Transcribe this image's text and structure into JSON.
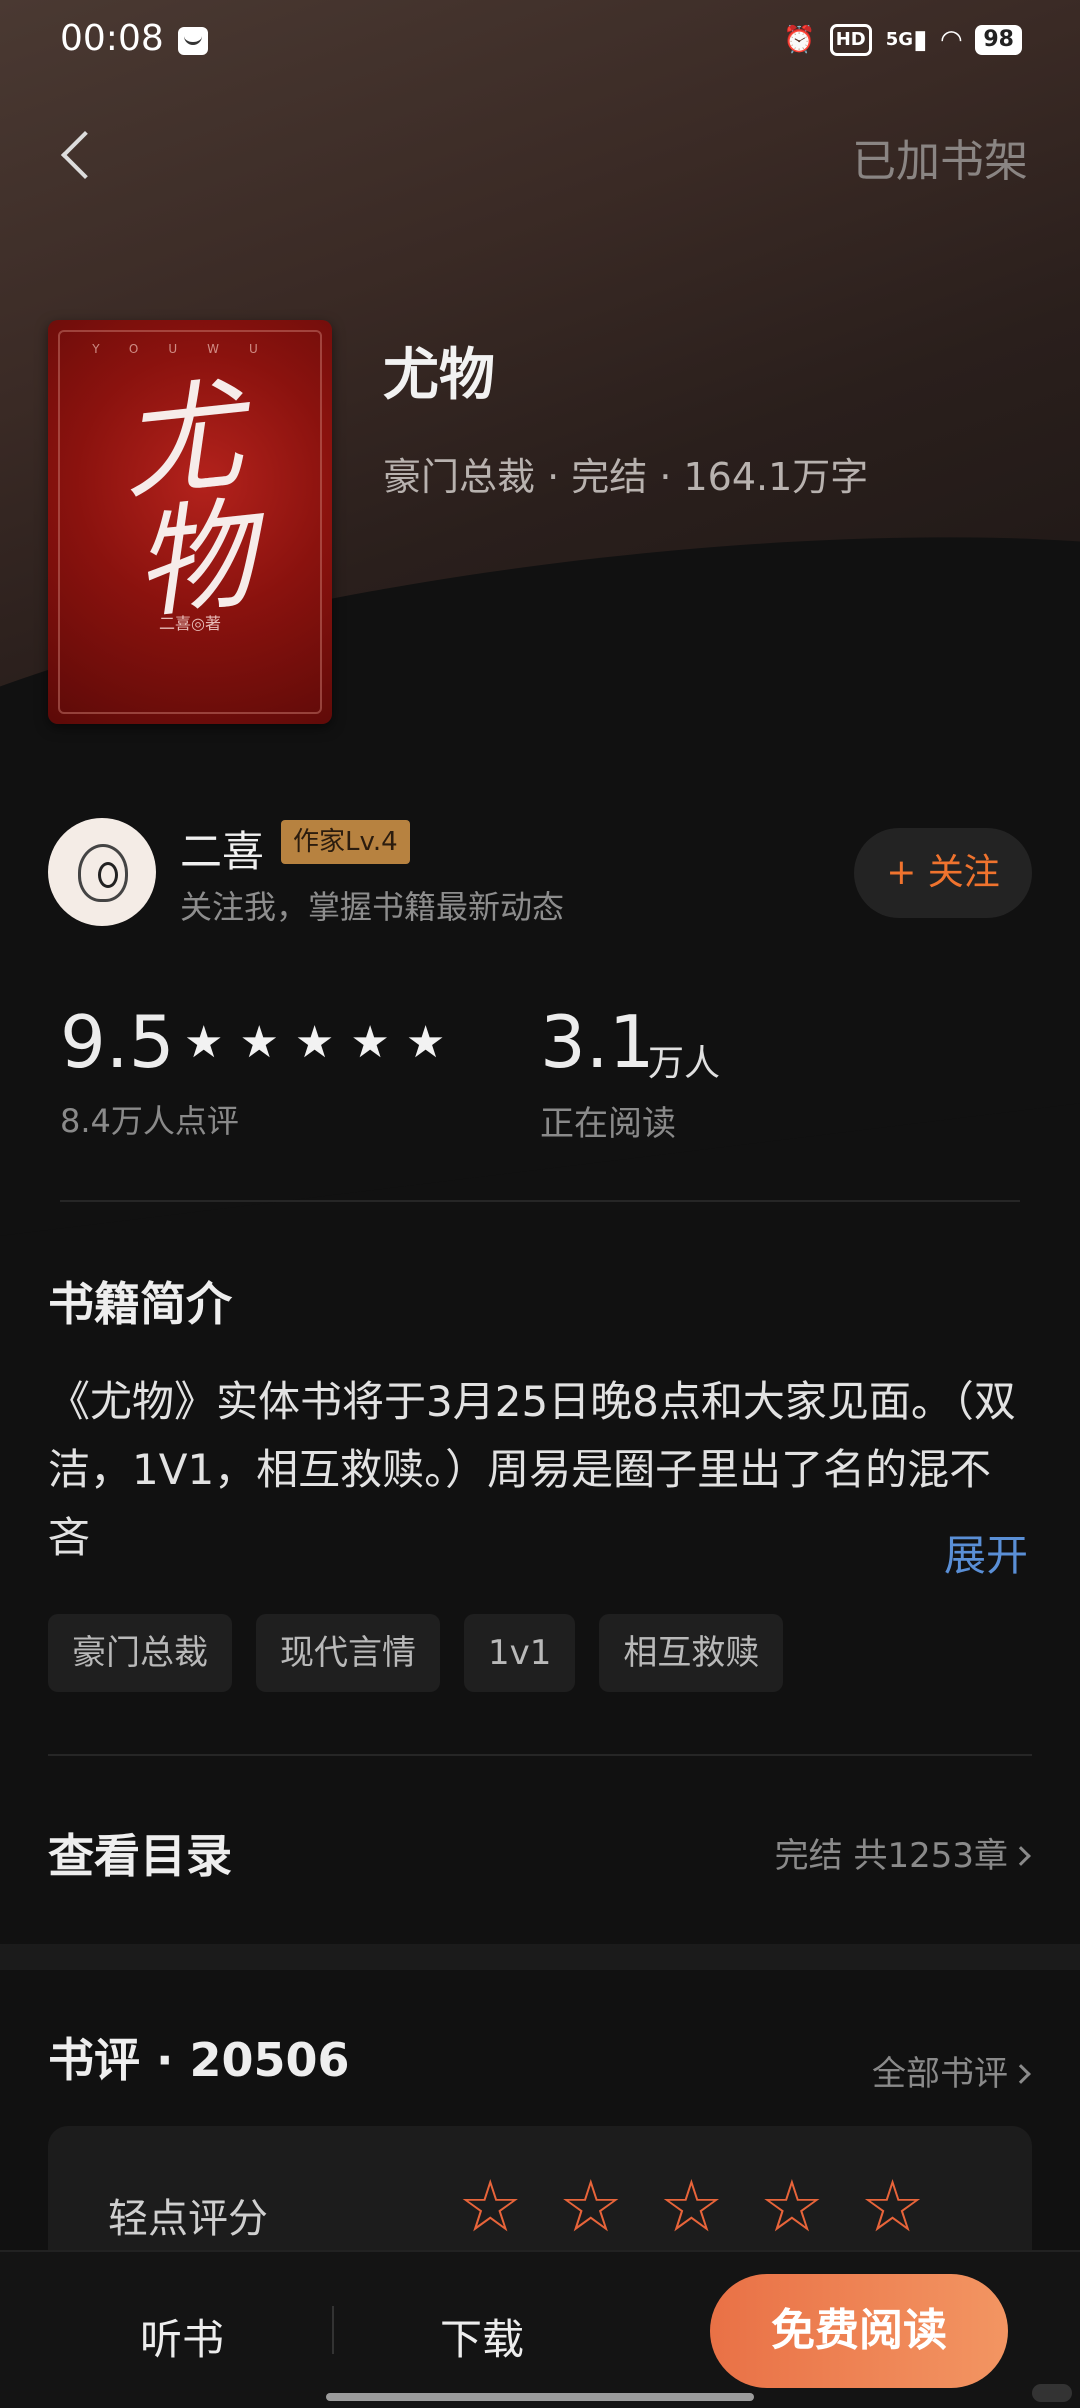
{
  "status_bar": {
    "time": "00:08",
    "network": "5G",
    "hd": "HD",
    "battery": "98"
  },
  "header": {
    "shelf_status": "已加书架"
  },
  "book": {
    "cover": {
      "top_text": "YOUWU",
      "title": "尤物",
      "author_line": "二喜◎著"
    },
    "title": "尤物",
    "meta": "豪门总裁 · 完结 · 164.1万字"
  },
  "author": {
    "name": "二喜",
    "badge": "作家Lv.4",
    "desc": "关注我，掌握书籍最新动态",
    "follow_label": "+ 关注"
  },
  "stats": {
    "score": "9.5",
    "score_stars": 5,
    "score_count": "8.4万人点评",
    "readers": "3.1",
    "readers_unit": "万人",
    "readers_label": "正在阅读"
  },
  "intro": {
    "title": "书籍简介",
    "text": "《尤物》实体书将于3月25日晚8点和大家见面。（双洁，1V1，相互救赎。）周易是圈子里出了名的混不吝",
    "expand_label": "展开",
    "tags": [
      "豪门总裁",
      "现代言情",
      "1v1",
      "相互救赎"
    ]
  },
  "toc": {
    "title": "查看目录",
    "info": "完结 共1253章"
  },
  "reviews": {
    "title": "书评 · 20506",
    "all_label": "全部书评",
    "rate_label": "轻点评分"
  },
  "bottom_bar": {
    "listen_label": "听书",
    "download_label": "下载",
    "read_label": "免费阅读"
  },
  "colors": {
    "accent": "#f0732e",
    "link": "#5a8fd6",
    "badge": "#b78240"
  }
}
